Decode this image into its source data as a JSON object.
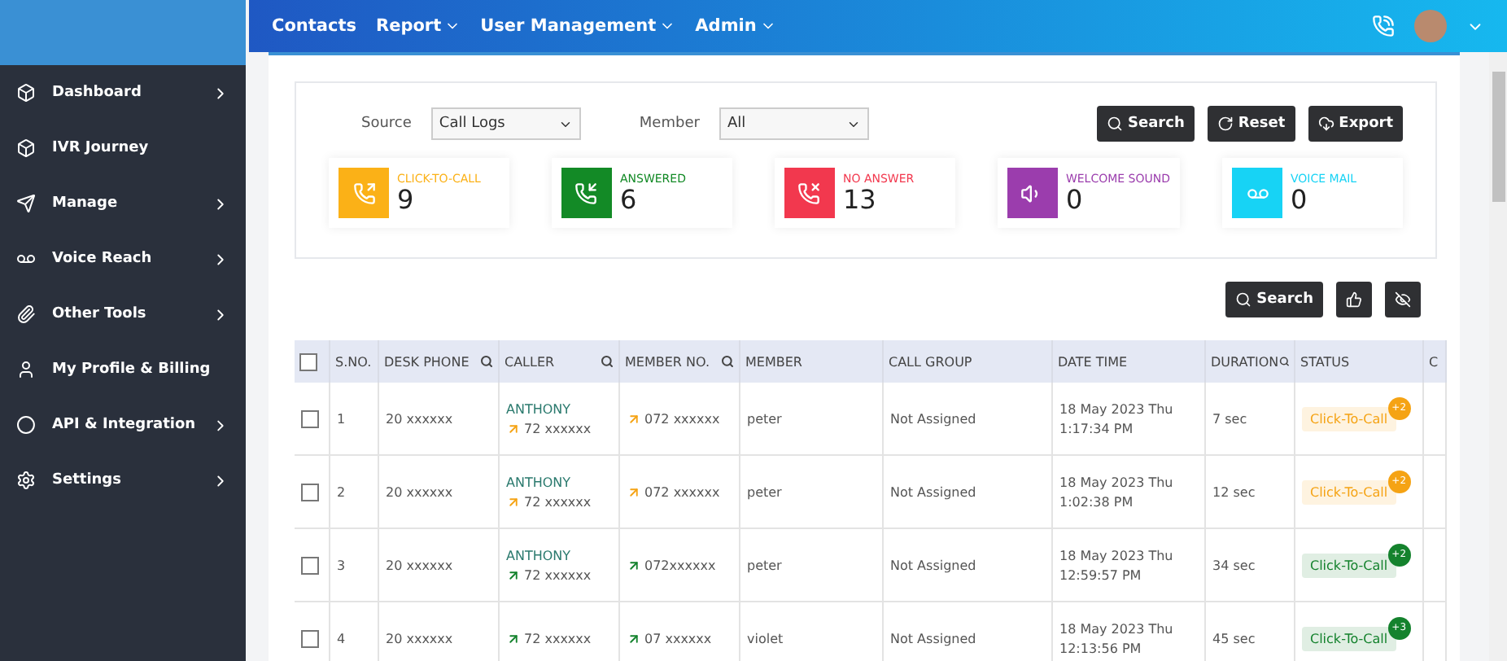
{
  "topbar": {
    "menu": [
      {
        "label": "Contacts",
        "dropdown": false
      },
      {
        "label": "Report",
        "dropdown": true
      },
      {
        "label": "User Management",
        "dropdown": true
      },
      {
        "label": "Admin",
        "dropdown": true
      }
    ]
  },
  "sidebar": {
    "items": [
      {
        "label": "Dashboard",
        "arrow": true
      },
      {
        "label": "IVR Journey",
        "arrow": false
      },
      {
        "label": "Manage",
        "arrow": true
      },
      {
        "label": "Voice Reach",
        "arrow": true
      },
      {
        "label": "Other Tools",
        "arrow": true
      },
      {
        "label": "My Profile & Billing",
        "arrow": false
      },
      {
        "label": "API & Integration",
        "arrow": true
      },
      {
        "label": "Settings",
        "arrow": true
      }
    ]
  },
  "filters": {
    "source": {
      "label": "Source",
      "value": "Call Logs"
    },
    "member": {
      "label": "Member",
      "value": "All"
    },
    "buttons": [
      "Search",
      "Reset",
      "Export"
    ]
  },
  "stats": [
    {
      "label": "CLICK-TO-CALL",
      "value": "9",
      "color": "#fbb117"
    },
    {
      "label": "ANSWERED",
      "value": "6",
      "color": "#138a26"
    },
    {
      "label": "NO ANSWER",
      "value": "13",
      "color": "#f2384e"
    },
    {
      "label": "WELCOME SOUND",
      "value": "0",
      "color": "#9b3dad"
    },
    {
      "label": "VOICE MAIL",
      "value": "0",
      "color": "#17d3f5"
    }
  ],
  "table_tools": {
    "search": "Search"
  },
  "table": {
    "all_checked": false,
    "columns": [
      {
        "label": "S.NO.",
        "search": false
      },
      {
        "label": "DESK PHONE",
        "search": true
      },
      {
        "label": "CALLER",
        "search": true
      },
      {
        "label": "MEMBER NO.",
        "search": true
      },
      {
        "label": "MEMBER",
        "search": false
      },
      {
        "label": "CALL GROUP",
        "search": false
      },
      {
        "label": "DATE TIME",
        "search": false
      },
      {
        "label": "DURATION",
        "search": true
      },
      {
        "label": "STATUS",
        "search": false
      },
      {
        "label": "C",
        "search": false
      }
    ],
    "rows": [
      {
        "sno": "1",
        "desk": "20 xxxxxx",
        "caller_name": "ANTHONY",
        "caller_no": "72  xxxxxx",
        "member_no": "072 xxxxxx",
        "member": "peter",
        "group": "Not Assigned",
        "date": "18 May 2023 Thu",
        "time": "1:17:34 PM",
        "duration": "7 sec",
        "status": "Click-To-Call",
        "count": "+2",
        "color": "#f5a314",
        "checked": false
      },
      {
        "sno": "2",
        "desk": "20 xxxxxx",
        "caller_name": "ANTHONY",
        "caller_no": "72  xxxxxx",
        "member_no": "072 xxxxxx",
        "member": "peter",
        "group": "Not Assigned",
        "date": "18 May 2023 Thu",
        "time": "1:02:38 PM",
        "duration": "12 sec",
        "status": "Click-To-Call",
        "count": "+2",
        "color": "#f5a314",
        "checked": false
      },
      {
        "sno": "3",
        "desk": "20 xxxxxx",
        "caller_name": "ANTHONY",
        "caller_no": "72  xxxxxx",
        "member_no": "072xxxxxx",
        "member": "peter",
        "group": "Not Assigned",
        "date": "18 May 2023 Thu",
        "time": "12:59:57 PM",
        "duration": "34 sec",
        "status": "Click-To-Call",
        "count": "+2",
        "color": "#14822d",
        "checked": false
      },
      {
        "sno": "4",
        "desk": "20 xxxxxx",
        "caller_no": "72  xxxxxx",
        "member_no": "07 xxxxxx",
        "member": "violet",
        "group": "Not Assigned",
        "date": "18 May 2023 Thu",
        "time": "12:13:56 PM",
        "duration": "45 sec",
        "status": "Click-To-Call",
        "count": "+3",
        "color": "#14822d",
        "checked": false
      }
    ]
  }
}
